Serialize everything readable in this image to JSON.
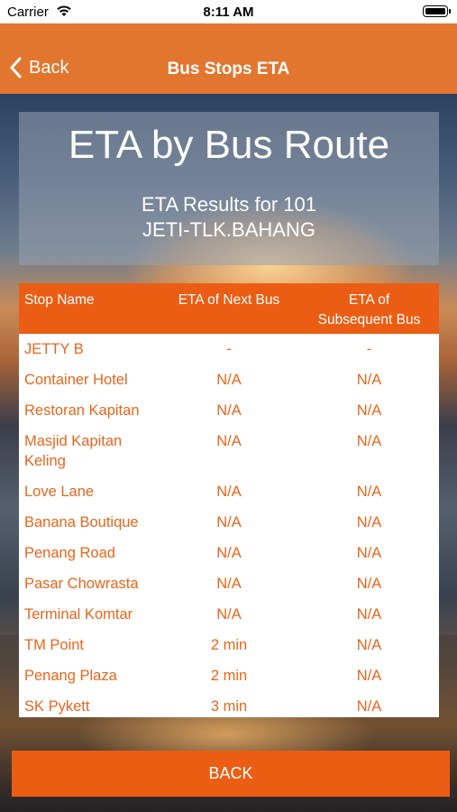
{
  "status": {
    "carrier": "Carrier",
    "time": "8:11 AM"
  },
  "nav": {
    "back_label": "Back",
    "title": "Bus Stops ETA"
  },
  "header": {
    "title": "ETA by Bus Route",
    "subtitle_line1": "ETA Results for 101",
    "subtitle_line2": "JETI-TLK.BAHANG"
  },
  "table": {
    "columns": [
      "Stop Name",
      "ETA of Next Bus",
      "ETA of",
      "Subsequent Bus"
    ],
    "rows": [
      {
        "stop": "JETTY B",
        "next": "-",
        "subsequent": "-"
      },
      {
        "stop": "Container Hotel",
        "next": "N/A",
        "subsequent": "N/A"
      },
      {
        "stop": "Restoran Kapitan",
        "next": "N/A",
        "subsequent": "N/A"
      },
      {
        "stop": "Masjid Kapitan",
        "stop2": "Keling",
        "next": "N/A",
        "subsequent": "N/A"
      },
      {
        "stop": "Love Lane",
        "next": "N/A",
        "subsequent": "N/A"
      },
      {
        "stop": "Banana Boutique",
        "next": "N/A",
        "subsequent": "N/A"
      },
      {
        "stop": "Penang Road",
        "next": "N/A",
        "subsequent": "N/A"
      },
      {
        "stop": "Pasar Chowrasta",
        "next": "N/A",
        "subsequent": "N/A"
      },
      {
        "stop": "Terminal Komtar",
        "next": "N/A",
        "subsequent": "N/A"
      },
      {
        "stop": "TM Point",
        "next": "2 min",
        "subsequent": "N/A"
      },
      {
        "stop": "Penang Plaza",
        "next": "2 min",
        "subsequent": "N/A"
      },
      {
        "stop": "SK Pykett",
        "next": "3 min",
        "subsequent": "N/A"
      }
    ]
  },
  "footer": {
    "back_button_label": "BACK"
  },
  "colors": {
    "nav_bar": "#e2762f",
    "accent": "#eb5d13",
    "cell_text": "#e8651c"
  }
}
